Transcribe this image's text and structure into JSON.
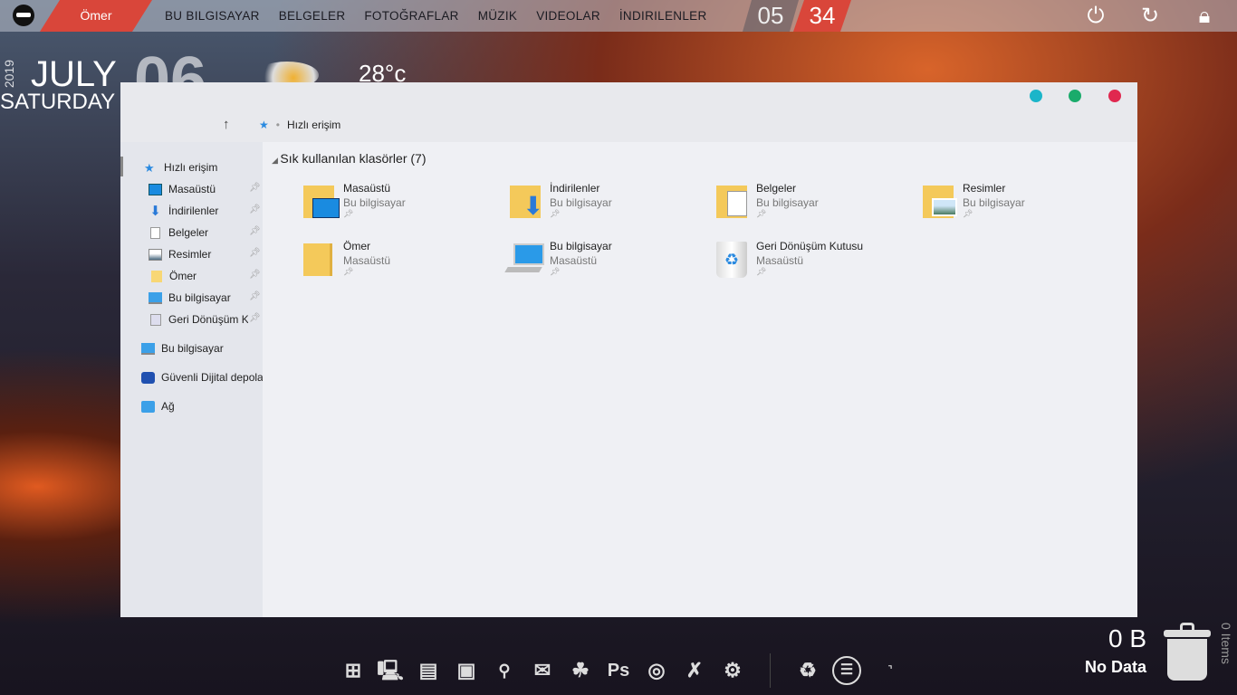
{
  "topbar": {
    "user": "Ömer",
    "nav": [
      "BU BILGISAYAR",
      "BELGELER",
      "FOTOĞRAFLAR",
      "MÜZIK",
      "VIDEOLAR",
      "İNDIRILENLER"
    ],
    "clock": {
      "hour": "05",
      "minute": "34"
    }
  },
  "desktop": {
    "year": "2019",
    "month": "JULY",
    "day": "06",
    "weekday": "SATURDAY",
    "temperature": "28°c"
  },
  "explorer": {
    "breadcrumb": "Hızlı erişim",
    "section_title": "Sık kullanılan klasörler (7)",
    "sidebar": [
      {
        "label": "Hızlı erişim",
        "icon": "star-icon"
      },
      {
        "label": "Masaüstü",
        "icon": "desktop-icon",
        "pinned": true
      },
      {
        "label": "İndirilenler",
        "icon": "download-icon",
        "pinned": true
      },
      {
        "label": "Belgeler",
        "icon": "document-icon",
        "pinned": true
      },
      {
        "label": "Resimler",
        "icon": "picture-icon",
        "pinned": true
      },
      {
        "label": "Ömer",
        "icon": "folder-icon",
        "pinned": true
      },
      {
        "label": "Bu bilgisayar",
        "icon": "computer-icon",
        "pinned": true
      },
      {
        "label": "Geri Dönüşüm K",
        "icon": "recycle-bin-icon",
        "pinned": true
      },
      {
        "label": "Bu bilgisayar",
        "icon": "computer-icon"
      },
      {
        "label": "Güvenli Dijital depola",
        "icon": "sd-storage-icon"
      },
      {
        "label": "Ağ",
        "icon": "network-icon"
      }
    ],
    "folders": [
      {
        "name": "Masaüstü",
        "location": "Bu bilgisayar"
      },
      {
        "name": "İndirilenler",
        "location": "Bu bilgisayar"
      },
      {
        "name": "Belgeler",
        "location": "Bu bilgisayar"
      },
      {
        "name": "Resimler",
        "location": "Bu bilgisayar"
      },
      {
        "name": "Ömer",
        "location": "Masaüstü"
      },
      {
        "name": "Bu bilgisayar",
        "location": "Masaüstü"
      },
      {
        "name": "Geri Dönüşüm Kutusu",
        "location": "Masaüstü"
      }
    ],
    "colors": {
      "minimize": "#1bb5c9",
      "maximize": "#1aab6b",
      "close": "#e0284f"
    }
  },
  "dock": {
    "ps_label": "Ps"
  },
  "recycle": {
    "size": "0 B",
    "status": "No Data",
    "items": "0 Items"
  }
}
